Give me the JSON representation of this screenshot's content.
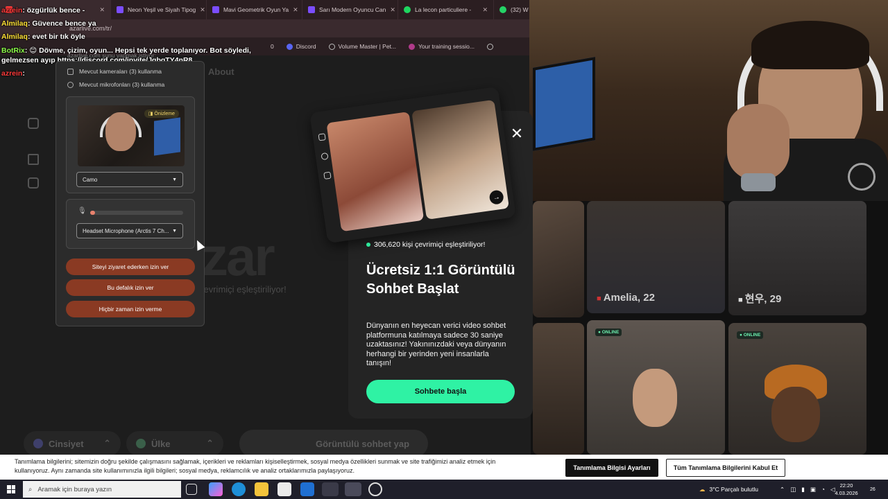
{
  "browser": {
    "tabs": [
      {
        "label": "Neon Yeşil ve Siyah Tipog",
        "color": "#7b4dff"
      },
      {
        "label": "Mavi Geometrik Oyun Ya",
        "color": "#7b4dff"
      },
      {
        "label": "Sarı Modern Oyuncu Can",
        "color": "#7b4dff"
      },
      {
        "label": "La lecon particuliere -",
        "color": "#1ed760"
      },
      {
        "label": "(32) W",
        "color": "#25d366"
      }
    ],
    "address": "azarlive.com/tr/",
    "bookmarks": [
      "Discord",
      "Volume Master | Pet...",
      "Your training sessio..."
    ],
    "bookmark_count": "0"
  },
  "chat": [
    {
      "user": "azrein",
      "text": ": özgürlük bence -"
    },
    {
      "user": "Almilaq",
      "text": ": Güvence bence ya"
    },
    {
      "user": "Almilaq",
      "text": ": evet bir tık öyle"
    },
    {
      "user": "BotRix",
      "text": ": 😊 Dövme, çizim, oyun... Hepsi tek yerde toplanıyor. Bot söyledi, gelmezsen ayıp https://discord.com/invite/JqbqTY4nR8"
    },
    {
      "user": "azrein",
      "text": ":"
    }
  ],
  "site": {
    "nav_about": "About",
    "logo": "zar",
    "online_sub": "çevrimiçi eşleştiriliyor!",
    "filters": {
      "gender": "Cinsiyet",
      "country": "Ülke"
    },
    "video_cta": "Görüntülü sohbet yap"
  },
  "permission": {
    "title": "azarlive.com şunu yapmak istiyor:",
    "camera_row": "Mevcut kameraları (3) kullanma",
    "mic_row": "Mevcut mikrofonları (3) kullanma",
    "preview_badge": "Önizleme",
    "camera_select": "Camo",
    "mic_select": "Headset Microphone (Arctis 7 Ch...",
    "mic_level": 0.02,
    "buttons": {
      "allow_visit": "Siteyi ziyaret ederken izin ver",
      "allow_once": "Bu defalık izin ver",
      "never": "Hiçbir zaman izin verme"
    }
  },
  "grid": {
    "cards": [
      {
        "name": "Amelia, 22",
        "online": ""
      },
      {
        "name": "현우, 29",
        "online": ""
      },
      {
        "name": "",
        "online": "ONLINE"
      },
      {
        "name": "",
        "online": "ONLINE"
      }
    ]
  },
  "modal": {
    "online_count": "306,620 kişi çevrimiçi eşleştiriliyor!",
    "title": "Ücretsiz 1:1 Görüntülü Sohbet Başlat",
    "description": "Dünyanın en heyecan verici video sohbet platformuna katılmaya sadece 30 saniye uzaktasınız! Yakınınızdaki veya dünyanın herhangi bir yerinden yeni insanlarla tanışın!",
    "cta": "Sohbete başla",
    "accent": "#2ff2a4"
  },
  "cookie": {
    "text": "Tanımlama bilgilerini; sitemizin doğru şekilde çalışmasını sağlamak, içerikleri ve reklamları kişiselleştirmek, sosyal medya özellikleri sunmak ve site trafiğimizi analiz etmek için kullanıyoruz. Aynı zamanda site kullanımınızla ilgili bilgileri; sosyal medya, reklamcılık ve analiz ortaklarımızla paylaşıyoruz.",
    "settings_button": "Tanımlama Bilgisi Ayarları",
    "accept_button": "Tüm Tanımlama Bilgilerini Kabul Et"
  },
  "taskbar": {
    "search_placeholder": "Aramak için buraya yazın",
    "weather": "3°C  Parçalı bulutlu",
    "time": "22:20",
    "date": "4.03.2026",
    "notif_count": "26"
  }
}
